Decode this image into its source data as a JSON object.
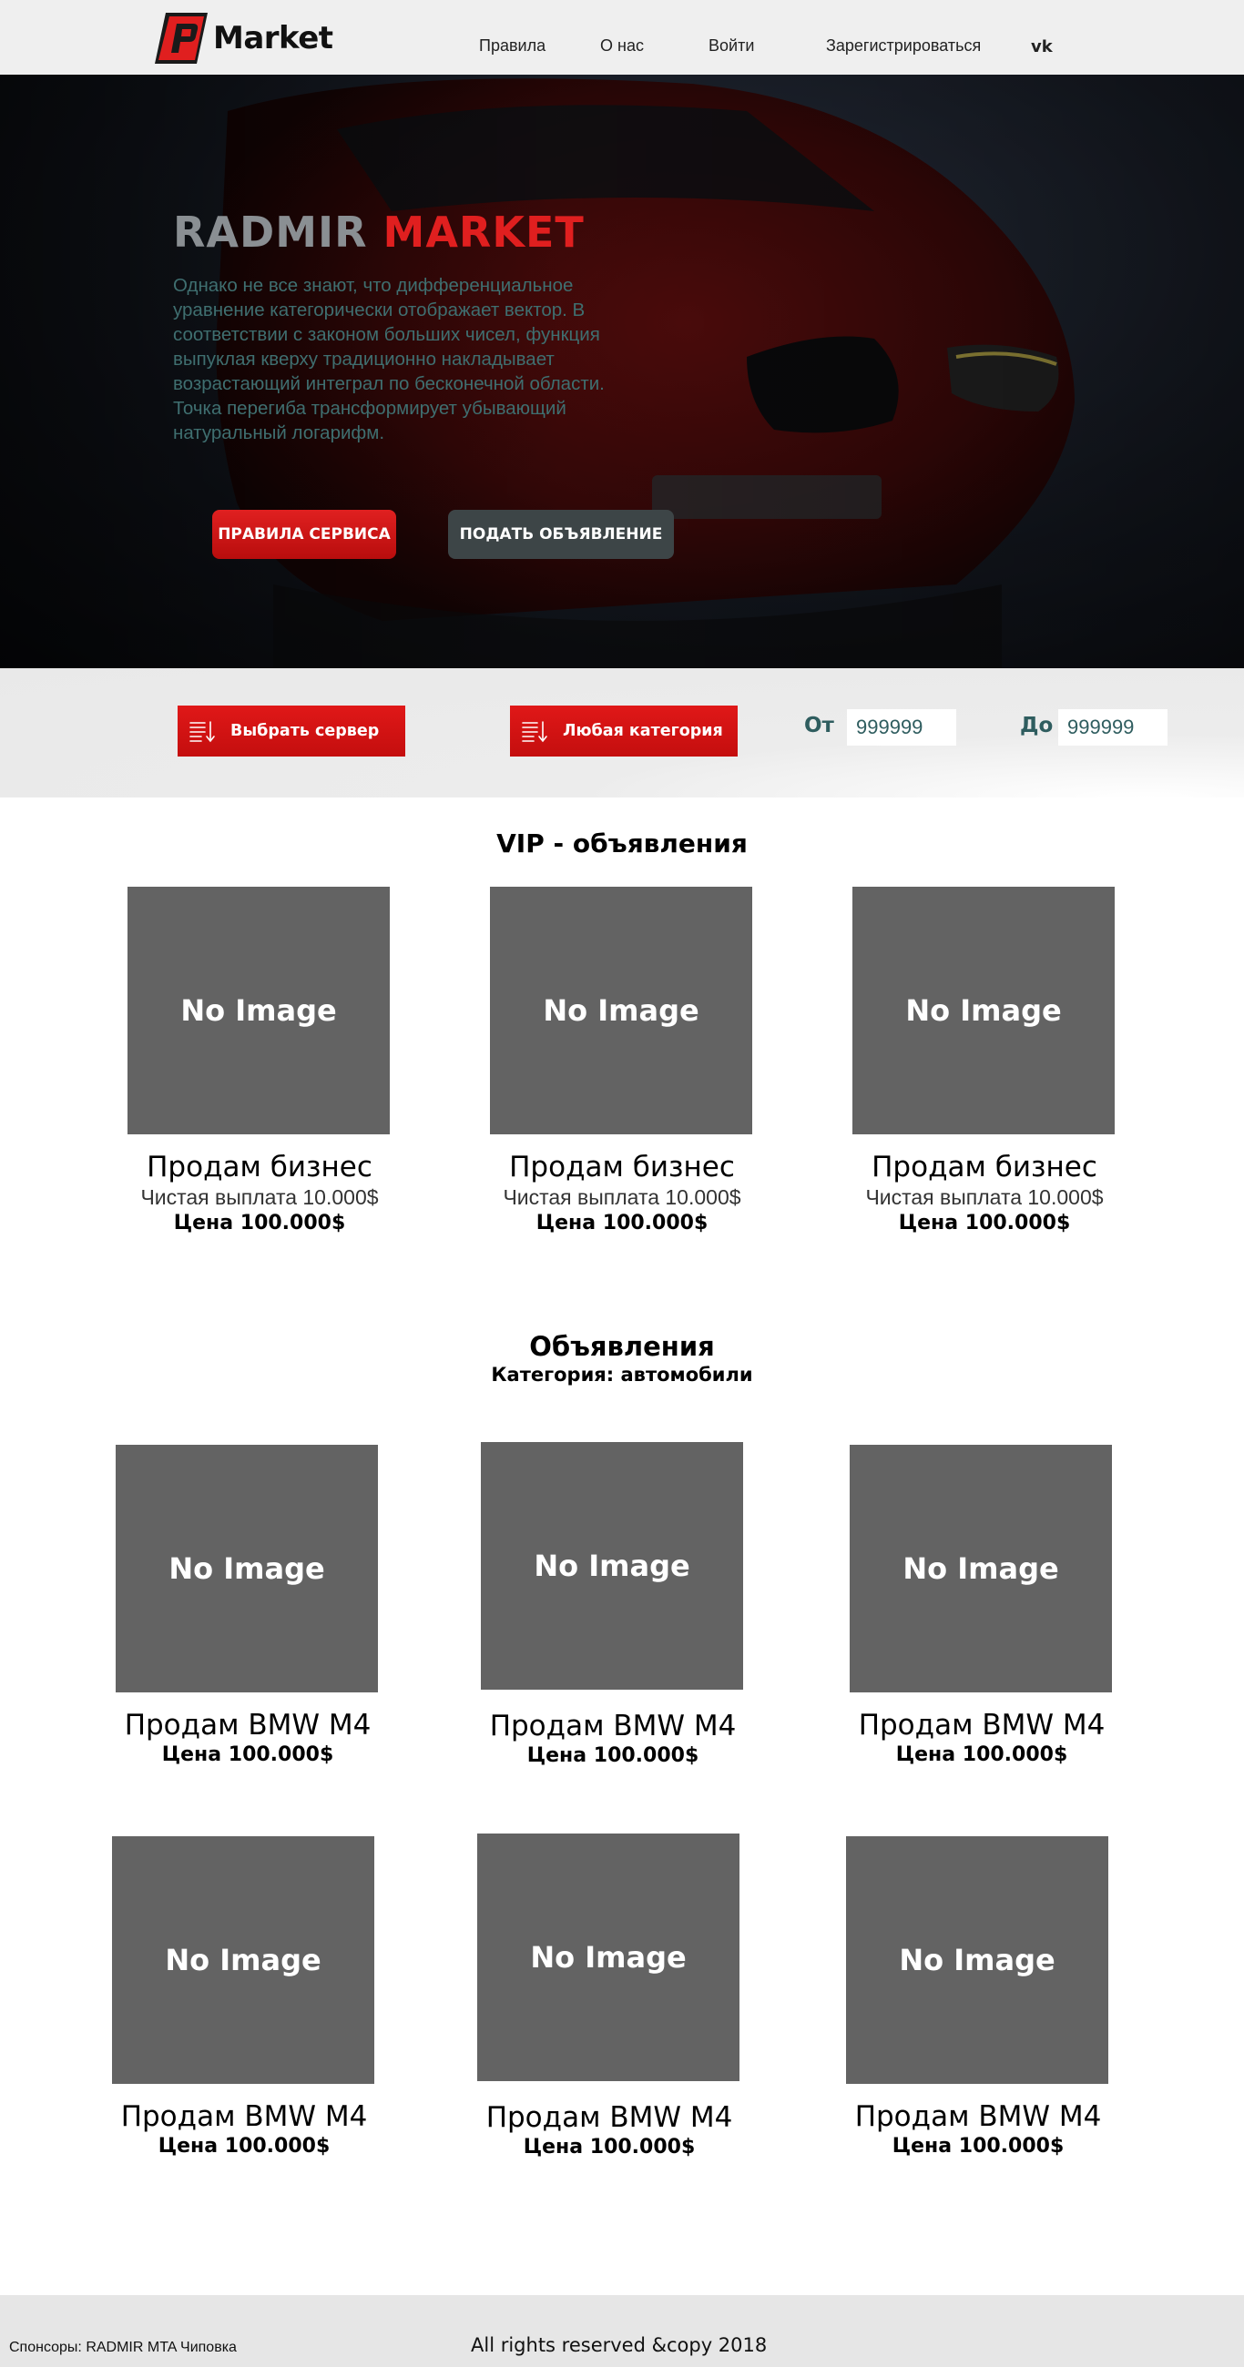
{
  "header": {
    "logo_text": "Market",
    "nav": [
      {
        "label": "Правила"
      },
      {
        "label": "О нас"
      },
      {
        "label": "Войти"
      },
      {
        "label": "Зарегистрироваться"
      }
    ],
    "social_icon": "vk-icon",
    "social_label": "vk"
  },
  "hero": {
    "title_part1": "RADMIR",
    "title_part2": "MARKET",
    "text": "Однако не все знают, что дифференциальное уравнение категорически отображает вектор. В соответствии с законом больших чисел, функция выпуклая кверху традиционно накладывает возрастающий интеграл по бесконечной области. Точка перегиба трансформирует убывающий натуральный логарифм.",
    "btn_rules": "ПРАВИЛА СЕРВИСА",
    "btn_post": "ПОДАТЬ ОБЪЯВЛЕНИЕ"
  },
  "filter": {
    "server_label": "Выбрать сервер",
    "category_label": "Любая категория",
    "from_label": "От",
    "from_value": "999999",
    "to_label": "До",
    "to_value": "999999",
    "icon": "sort-list-icon"
  },
  "vip": {
    "title": "VIP - объявления",
    "items": [
      {
        "image": "No Image",
        "title": "Продам бизнес",
        "sub": "Чистая выплата 10.000$",
        "price": "Цена 100.000$"
      },
      {
        "image": "No Image",
        "title": "Продам бизнес",
        "sub": "Чистая выплата 10.000$",
        "price": "Цена 100.000$"
      },
      {
        "image": "No Image",
        "title": "Продам бизнес",
        "sub": "Чистая выплата 10.000$",
        "price": "Цена 100.000$"
      }
    ]
  },
  "ads": {
    "title": "Объявления",
    "subtitle": "Категория: автомобили",
    "items": [
      {
        "image": "No Image",
        "title": "Продам BMW M4",
        "price": "Цена 100.000$"
      },
      {
        "image": "No Image",
        "title": "Продам BMW M4",
        "price": "Цена 100.000$"
      },
      {
        "image": "No Image",
        "title": "Продам BMW M4",
        "price": "Цена 100.000$"
      },
      {
        "image": "No Image",
        "title": "Продам BMW M4",
        "price": "Цена 100.000$"
      },
      {
        "image": "No Image",
        "title": "Продам BMW M4",
        "price": "Цена 100.000$"
      },
      {
        "image": "No Image",
        "title": "Продам BMW M4",
        "price": "Цена 100.000$"
      }
    ]
  },
  "footer": {
    "sponsors": "Спонсоры: RADMIR MTA Чиповка",
    "copyright": "All rights reserved &copy 2018"
  },
  "colors": {
    "accent_red": "#e01f1f",
    "hero_text": "#3f6f70",
    "filter_text": "#2f5d5f",
    "placeholder_gray": "#636363",
    "secondary_button": "#3d4547"
  }
}
